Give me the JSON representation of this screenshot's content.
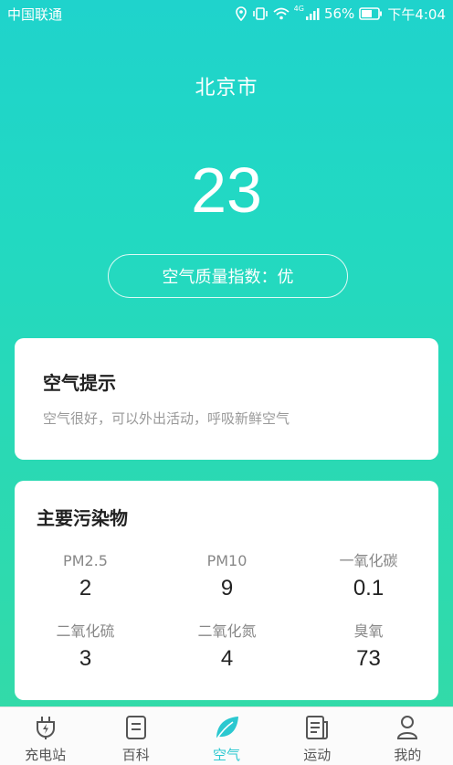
{
  "status_bar": {
    "carrier": "中国联通",
    "network": "4G",
    "battery": "56%",
    "time": "下午4:04"
  },
  "header": {
    "city": "北京市",
    "aqi_value": "23",
    "aqi_label": "空气质量指数：优"
  },
  "tips": {
    "title": "空气提示",
    "text": "空气很好，可以外出活动，呼吸新鲜空气"
  },
  "pollutants": {
    "title": "主要污染物",
    "items": [
      {
        "name": "PM2.5",
        "value": "2"
      },
      {
        "name": "PM10",
        "value": "9"
      },
      {
        "name": "一氧化碳",
        "value": "0.1"
      },
      {
        "name": "二氧化硫",
        "value": "3"
      },
      {
        "name": "二氧化氮",
        "value": "4"
      },
      {
        "name": "臭氧",
        "value": "73"
      }
    ]
  },
  "tabbar": {
    "active_color": "#2bc8d0",
    "items": [
      {
        "label": "充电站",
        "icon": "plug-icon"
      },
      {
        "label": "百科",
        "icon": "document-icon"
      },
      {
        "label": "空气",
        "icon": "leaf-icon"
      },
      {
        "label": "运动",
        "icon": "news-icon"
      },
      {
        "label": "我的",
        "icon": "user-icon"
      }
    ]
  }
}
